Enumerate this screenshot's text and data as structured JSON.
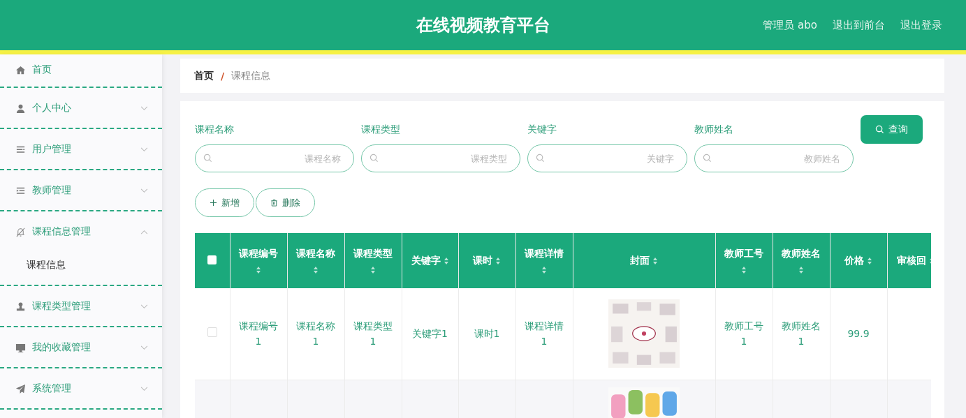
{
  "header": {
    "title": "在线视频教育平台",
    "links": [
      "管理员 abo",
      "退出到前台",
      "退出登录"
    ]
  },
  "sidebar": {
    "items": [
      {
        "label": "首页"
      },
      {
        "label": "个人中心",
        "expanded": false
      },
      {
        "label": "用户管理",
        "expanded": false
      },
      {
        "label": "教师管理",
        "expanded": false
      },
      {
        "label": "课程信息管理",
        "expanded": true,
        "children": [
          {
            "label": "课程信息",
            "selected": true
          }
        ]
      },
      {
        "label": "课程类型管理",
        "expanded": false
      },
      {
        "label": "我的收藏管理",
        "expanded": false
      },
      {
        "label": "系统管理",
        "expanded": false
      }
    ]
  },
  "breadcrumb": {
    "items": [
      "首页",
      "课程信息"
    ],
    "separator": "/"
  },
  "search": {
    "fields": [
      {
        "label": "课程名称",
        "placeholder": "课程名称"
      },
      {
        "label": "课程类型",
        "placeholder": "课程类型"
      },
      {
        "label": "关键字",
        "placeholder": "关键字"
      },
      {
        "label": "教师姓名",
        "placeholder": "教师姓名"
      }
    ],
    "button": "查询"
  },
  "actions": [
    {
      "kind": "add",
      "label": "新增"
    },
    {
      "kind": "delete",
      "label": "删除"
    }
  ],
  "table": {
    "select_all": {
      "checked": false
    },
    "columns": [
      "课程编号",
      "课程名称",
      "课程类型",
      "关键字",
      "课时",
      "课程详情",
      "封面",
      "教师工号",
      "教师姓名",
      "价格",
      "审核回"
    ],
    "rows": [
      {
        "checked": false,
        "cells": [
          "课程编号1",
          "课程名称1",
          "课程类型1",
          "关键字1",
          "课时1",
          "课程详情1",
          {
            "kind": "picture"
          },
          "教师工号1",
          "教师姓名1",
          "99.9"
        ]
      },
      {
        "cells": [
          "",
          "",
          "",
          "",
          "",
          "",
          {
            "kind": "picture"
          }
        ]
      }
    ]
  }
}
